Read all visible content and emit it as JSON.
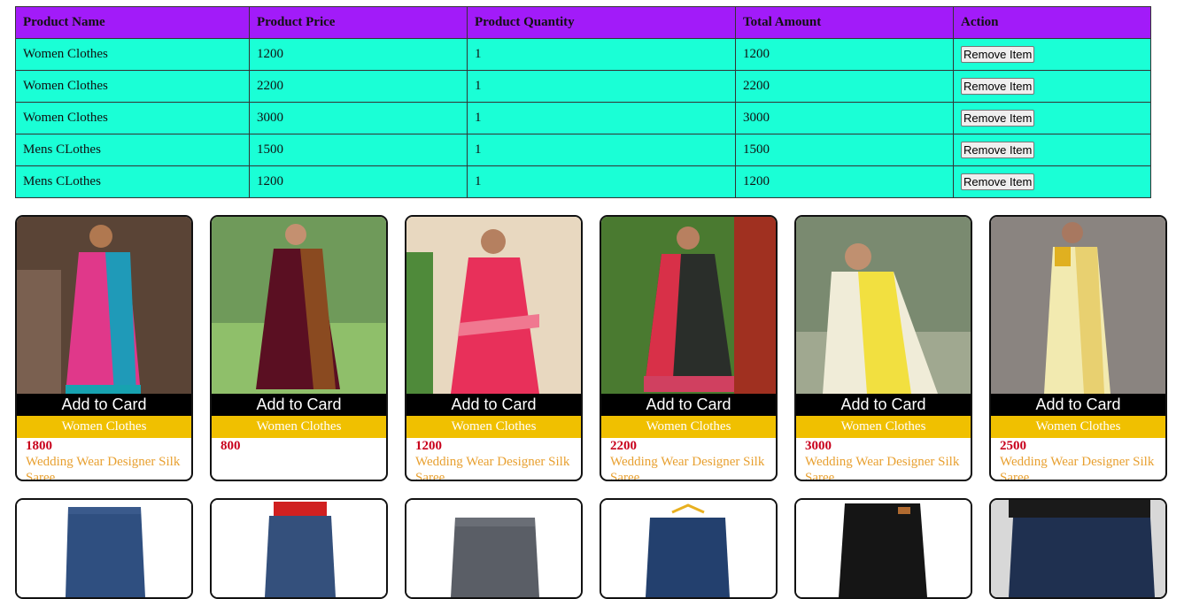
{
  "cart_table": {
    "headers": [
      "Product Name",
      "Product Price",
      "Product Quantity",
      "Total Amount",
      "Action"
    ],
    "rows": [
      {
        "name": "Women Clothes",
        "price": "1200",
        "qty": "1",
        "total": "1200",
        "action": "Remove Item"
      },
      {
        "name": "Women Clothes",
        "price": "2200",
        "qty": "1",
        "total": "2200",
        "action": "Remove Item"
      },
      {
        "name": "Women Clothes",
        "price": "3000",
        "qty": "1",
        "total": "3000",
        "action": "Remove Item"
      },
      {
        "name": "Mens CLothes",
        "price": "1500",
        "qty": "1",
        "total": "1500",
        "action": "Remove Item"
      },
      {
        "name": "Mens CLothes",
        "price": "1200",
        "qty": "1",
        "total": "1200",
        "action": "Remove Item"
      }
    ],
    "colors": {
      "header_bg": "#a21bf9",
      "row_bg": "#1affd6"
    }
  },
  "products": [
    {
      "button": "Add to Card",
      "category": "Women Clothes",
      "price": "1800",
      "title": "Wedding Wear Designer Silk",
      "title_more": "Saree",
      "image": "saree-pink-blue"
    },
    {
      "button": "Add to Card",
      "category": "Women Clothes",
      "price": "800",
      "title": "",
      "title_more": "",
      "image": "saree-maroon"
    },
    {
      "button": "Add to Card",
      "category": "Women Clothes",
      "price": "1200",
      "title": "Wedding Wear Designer Silk",
      "title_more": "Saree",
      "image": "saree-red-pink"
    },
    {
      "button": "Add to Card",
      "category": "Women Clothes",
      "price": "2200",
      "title": "Wedding Wear Designer Silk",
      "title_more": "Saree",
      "image": "saree-black-red"
    },
    {
      "button": "Add to Card",
      "category": "Women Clothes",
      "price": "3000",
      "title": "Wedding Wear Designer Silk",
      "title_more": "Saree",
      "image": "saree-yellow-white"
    },
    {
      "button": "Add to Card",
      "category": "Women Clothes",
      "price": "2500",
      "title": "Wedding Wear Designer Silk",
      "title_more": "Saree",
      "image": "saree-cream"
    }
  ],
  "products_row2_images": [
    "jeans-blue",
    "jeans-kid-model",
    "jeans-grey",
    "jeans-hanger",
    "jeans-black",
    "jeans-model-dark"
  ],
  "colors": {
    "category_bg": "#f0c000",
    "price": "#c8001c",
    "desc": "#e8a030",
    "button_bg": "#000000"
  }
}
